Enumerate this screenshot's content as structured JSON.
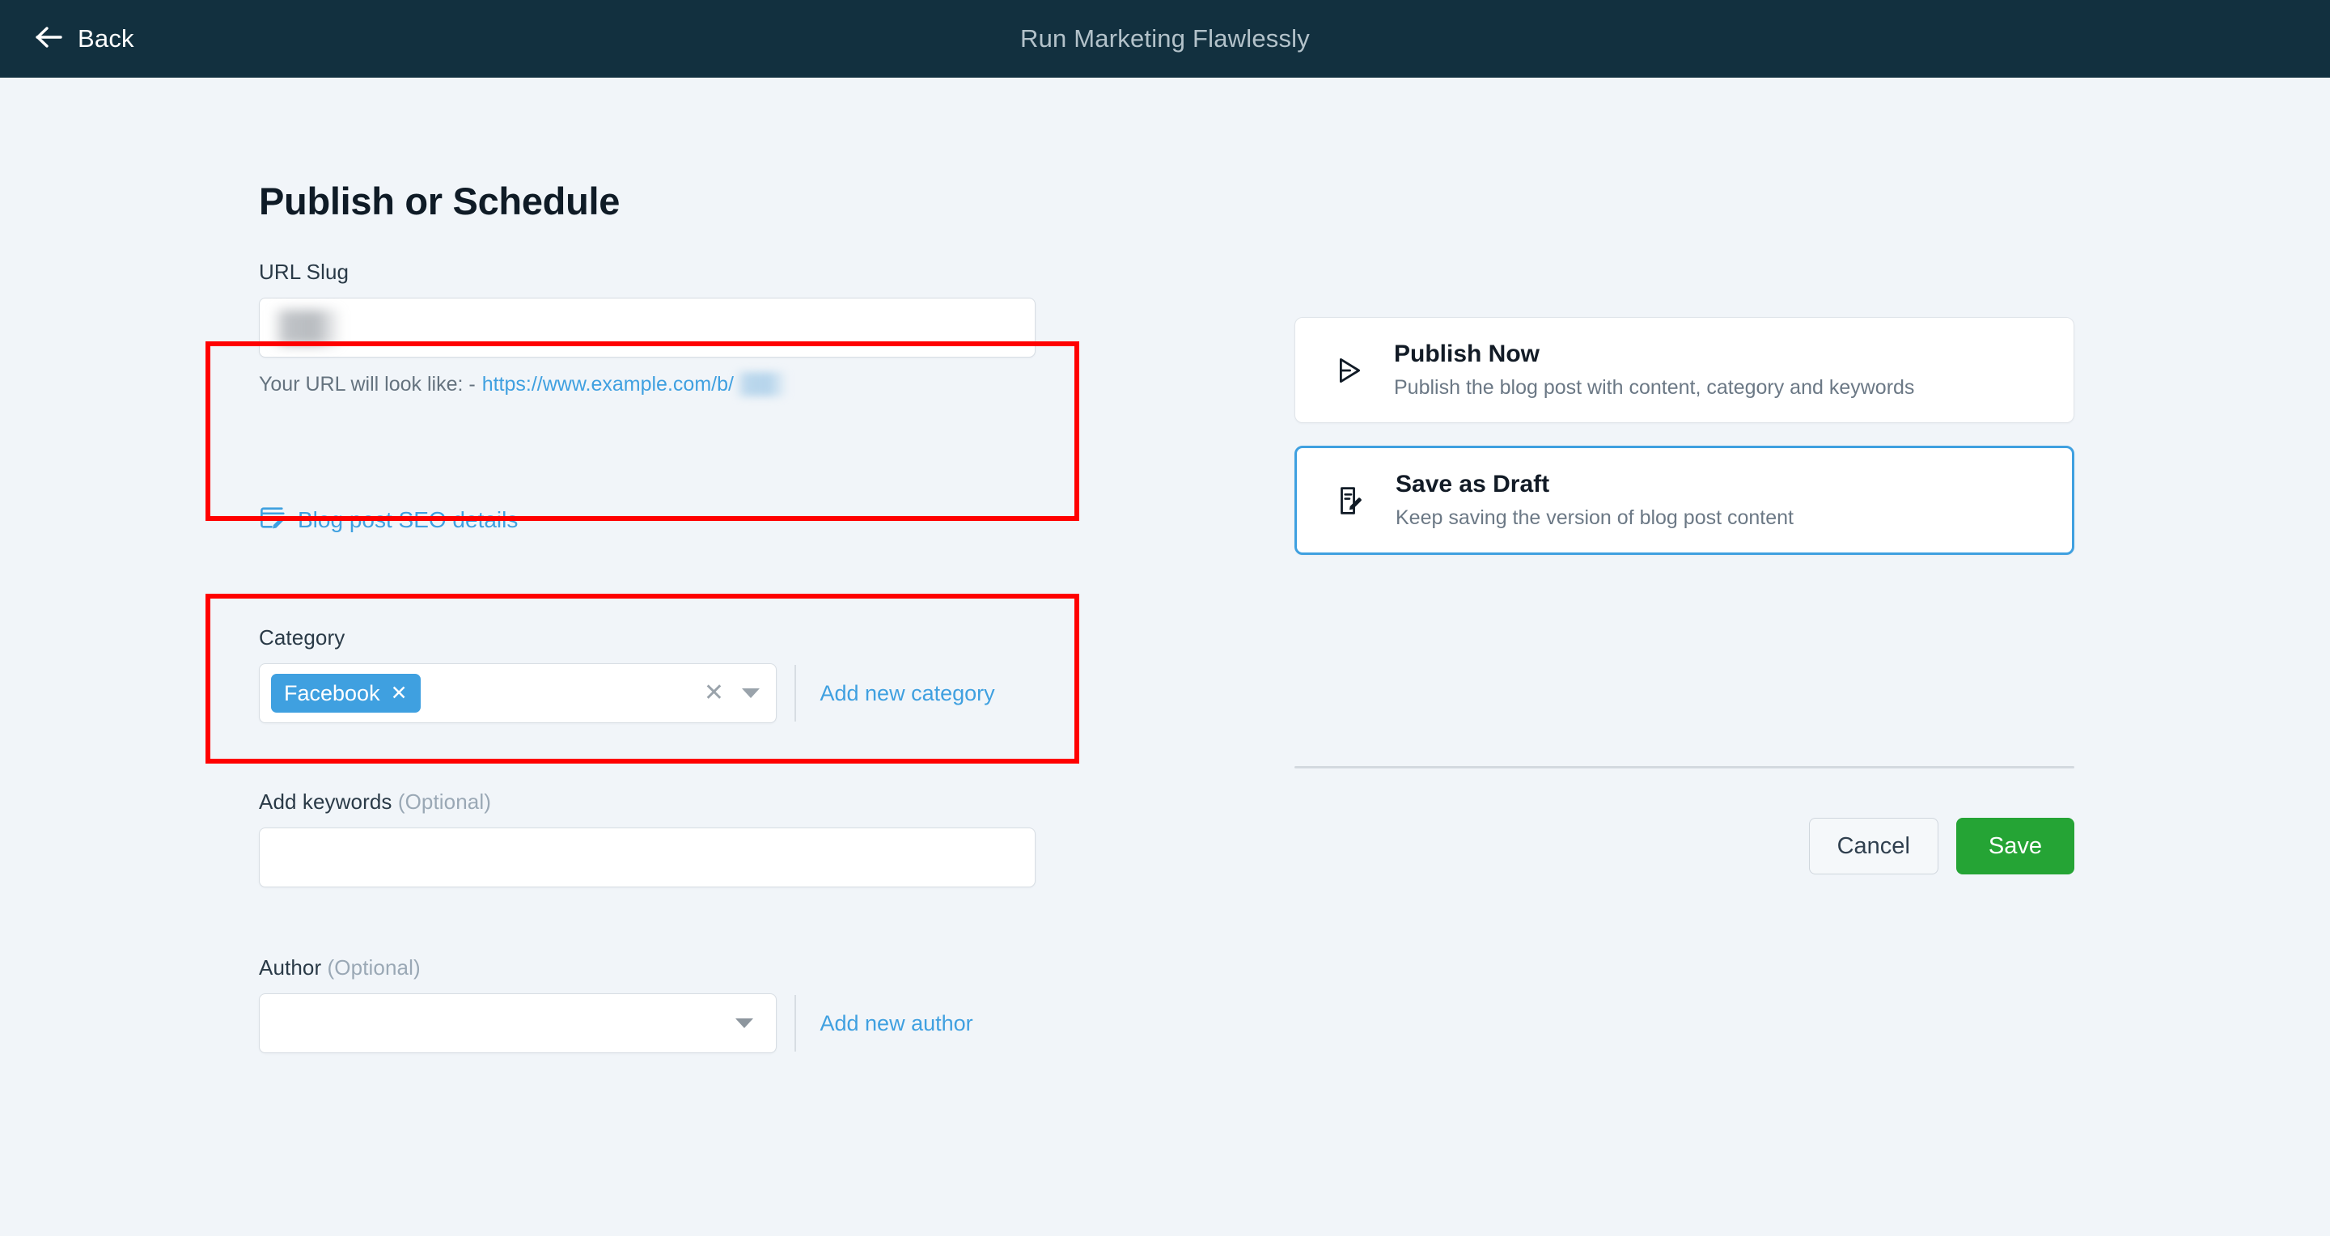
{
  "topbar": {
    "back_label": "Back",
    "back_icon": "arrow-left-icon",
    "title": "Run Marketing Flawlessly",
    "background_color": "#12303f",
    "title_color": "#b3c2ca"
  },
  "page": {
    "title": "Publish or Schedule",
    "background_color": "#f1f5f9"
  },
  "form": {
    "slug": {
      "label": "URL Slug",
      "value": "",
      "placeholder": "",
      "value_redacted": true,
      "hint_prefix": "Your URL will look like: -",
      "hint_url": "https://www.example.com/b/",
      "hint_url_redacted": true,
      "hint_color": "#65737f",
      "link_color": "#3fa0e0"
    },
    "seo_link": {
      "label": "Blog post SEO details",
      "icon": "edit-note-icon",
      "color": "#3fa0e0"
    },
    "category": {
      "label": "Category",
      "chips": [
        {
          "label": "Facebook",
          "remove_icon": "close-icon",
          "color": "#3fa0e0"
        }
      ],
      "clear_icon": "close-icon",
      "dropdown_icon": "chevron-down-icon",
      "add_link": "Add new category"
    },
    "keywords": {
      "label": "Add keywords",
      "optional_label": "(Optional)",
      "value": "",
      "placeholder": ""
    },
    "author": {
      "label": "Author",
      "optional_label": "(Optional)",
      "value": "",
      "placeholder": "",
      "dropdown_icon": "chevron-down-icon",
      "add_link": "Add new author"
    }
  },
  "annotations": [
    {
      "name": "url-slug-highlight",
      "color": "#ff0000"
    },
    {
      "name": "category-highlight",
      "color": "#ff0000"
    }
  ],
  "publish_options": [
    {
      "title": "Publish Now",
      "description": "Publish the blog post with content, category and keywords",
      "icon": "send-icon",
      "selected": false
    },
    {
      "title": "Save as Draft",
      "description": "Keep saving the version of blog post content",
      "icon": "draft-edit-icon",
      "selected": true
    }
  ],
  "actions": {
    "cancel_label": "Cancel",
    "save_label": "Save",
    "save_color": "#25a435"
  }
}
